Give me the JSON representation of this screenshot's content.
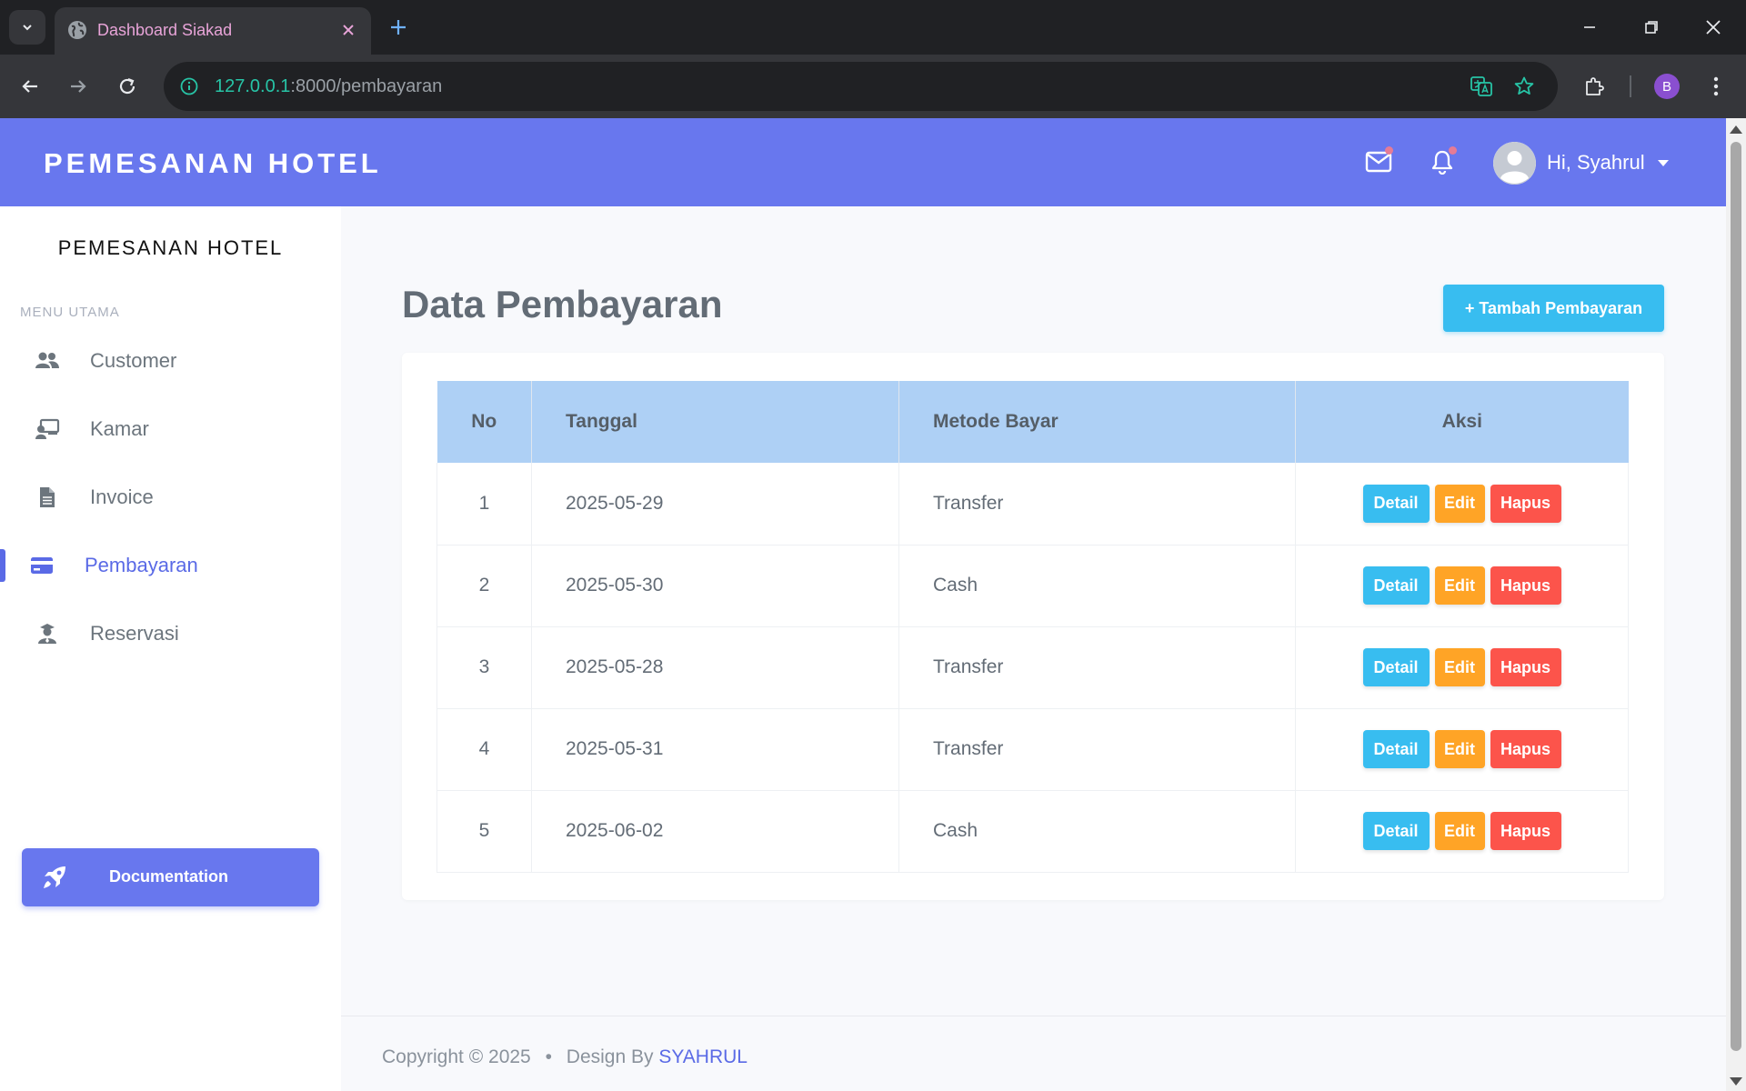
{
  "browser": {
    "tab_title": "Dashboard Siakad",
    "url_host": "127.0.0.1",
    "url_rest": ":8000/pembayaran",
    "profile_initial": "B"
  },
  "topbar": {
    "brand": "PEMESANAN HOTEL",
    "greeting": "Hi, Syahrul"
  },
  "sidebar": {
    "title": "PEMESANAN HOTEL",
    "section": "MENU UTAMA",
    "items": [
      {
        "label": "Customer",
        "icon": "users-icon"
      },
      {
        "label": "Kamar",
        "icon": "room-icon"
      },
      {
        "label": "Invoice",
        "icon": "file-icon"
      },
      {
        "label": "Pembayaran",
        "icon": "credit-card-icon",
        "active": true
      },
      {
        "label": "Reservasi",
        "icon": "user-tie-icon"
      }
    ],
    "doc_button": "Documentation"
  },
  "main": {
    "title": "Data Pembayaran",
    "add_button": "+ Tambah Pembayaran",
    "columns": [
      "No",
      "Tanggal",
      "Metode Bayar",
      "Aksi"
    ],
    "rows": [
      {
        "no": "1",
        "tanggal": "2025-05-29",
        "metode": "Transfer"
      },
      {
        "no": "2",
        "tanggal": "2025-05-30",
        "metode": "Cash"
      },
      {
        "no": "3",
        "tanggal": "2025-05-28",
        "metode": "Transfer"
      },
      {
        "no": "4",
        "tanggal": "2025-05-31",
        "metode": "Transfer"
      },
      {
        "no": "5",
        "tanggal": "2025-06-02",
        "metode": "Cash"
      }
    ],
    "actions": {
      "detail": "Detail",
      "edit": "Edit",
      "hapus": "Hapus"
    }
  },
  "footer": {
    "copyright": "Copyright © 2025",
    "separator": "•",
    "design_by": "Design By",
    "author": "SYAHRUL"
  },
  "colors": {
    "primary": "#6877ee",
    "info": "#38bdf0",
    "warning": "#ffa426",
    "danger": "#fc544b",
    "table_header": "#aed0f5"
  }
}
